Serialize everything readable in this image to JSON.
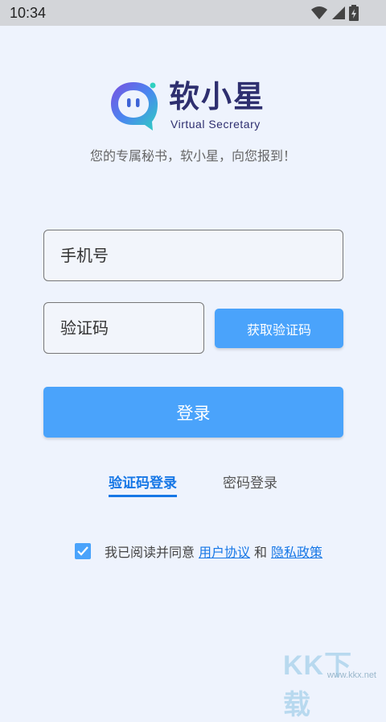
{
  "status_bar": {
    "time": "10:34",
    "icons": [
      "wifi-icon",
      "signal-icon",
      "battery-icon"
    ]
  },
  "logo": {
    "title": "软小星",
    "subtitle": "Virtual Secretary"
  },
  "tagline": "您的专属秘书，软小星，向您报到！",
  "form": {
    "phone_placeholder": "手机号",
    "code_placeholder": "验证码",
    "get_code_label": "获取验证码",
    "login_label": "登录"
  },
  "tabs": [
    {
      "label": "验证码登录",
      "active": true
    },
    {
      "label": "密码登录",
      "active": false
    }
  ],
  "agreement": {
    "checked": true,
    "prefix": "我已阅读并同意",
    "user_agreement": "用户协议",
    "and": "和",
    "privacy_policy": "隐私政策"
  },
  "watermark": {
    "big": "KK下载",
    "small": "www.kkx.net"
  },
  "colors": {
    "primary": "#4aa3fb",
    "link": "#1677e6",
    "background": "#eef3fd",
    "logo_text": "#2e2f6f"
  }
}
